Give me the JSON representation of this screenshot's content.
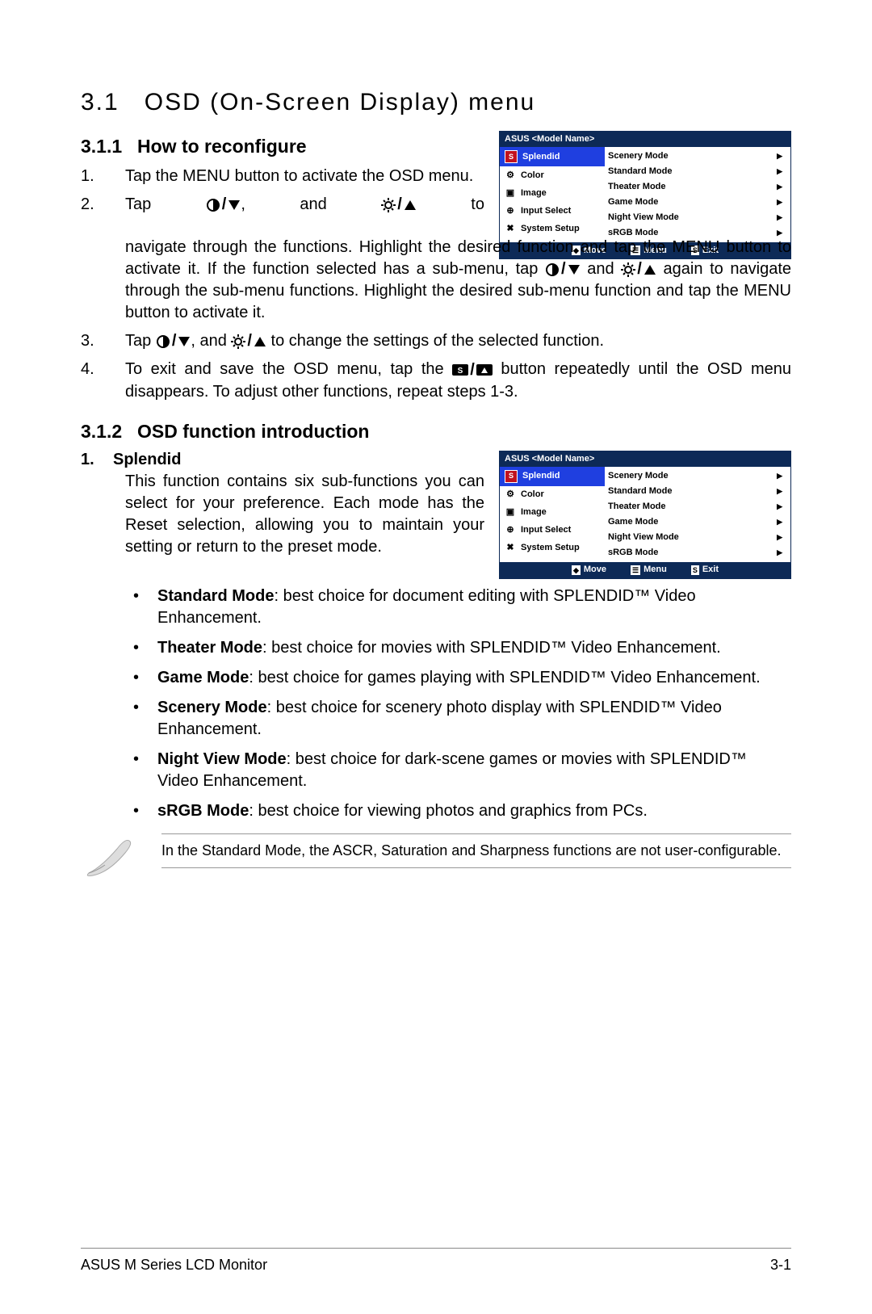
{
  "heading": {
    "num": "3.1",
    "title": "OSD (On-Screen Display) menu"
  },
  "sec311": {
    "num": "3.1.1",
    "title": "How to reconfigure",
    "li1": "Tap the MENU button to activate the OSD menu.",
    "li2a": "Tap ",
    "li2b": ", and ",
    "li2c": " to navigate through the functions. Highlight the desired function and tap the MENU button to activate it. If the function selected has a sub-menu, tap ",
    "li2d": " and ",
    "li2e": " again to navigate through the sub-menu functions. Highlight the desired sub-menu function and tap the MENU button to activate it.",
    "li3a": "Tap ",
    "li3b": ", and ",
    "li3c": " to change the settings of the selected function.",
    "li4a": "To exit and save the OSD menu, tap the ",
    "li4b": " button repeatedly until the OSD menu disappears. To adjust other functions, repeat steps 1-3."
  },
  "sec312": {
    "num": "3.1.2",
    "title": "OSD function introduction",
    "splendid_num": "1.",
    "splendid_title": "Splendid",
    "splendid_body": "This function contains six sub-functions you can select for your preference. Each mode has the Reset selection, allowing you to maintain your setting or return to the preset mode.",
    "bullets": [
      {
        "b": "Standard Mode",
        "t": ": best choice for document editing with SPLENDID™ Video Enhancement."
      },
      {
        "b": "Theater Mode",
        "t": ": best choice for movies with SPLENDID™ Video Enhancement."
      },
      {
        "b": "Game Mode",
        "t": ": best choice for games playing with SPLENDID™ Video Enhancement."
      },
      {
        "b": "Scenery Mode",
        "t": ": best choice for scenery photo display with SPLENDID™ Video Enhancement."
      },
      {
        "b": "Night View Mode",
        "t": ": best choice for dark-scene games or movies with SPLENDID™ Video Enhancement."
      },
      {
        "b": "sRGB Mode",
        "t": ": best choice for viewing photos and graphics from PCs."
      }
    ],
    "note": "In the Standard Mode, the ASCR, Saturation and Sharpness functions are not user-configurable."
  },
  "osd": {
    "title": "ASUS  <Model Name>",
    "left": [
      {
        "icon": "S",
        "label": "Splendid"
      },
      {
        "icon": "⚙",
        "label": "Color"
      },
      {
        "icon": "▣",
        "label": "Image"
      },
      {
        "icon": "⊕",
        "label": "Input Select"
      },
      {
        "icon": "✖",
        "label": "System Setup"
      }
    ],
    "right": [
      "Scenery Mode",
      "Standard Mode",
      "Theater Mode",
      "Game Mode",
      "Night View Mode",
      "sRGB Mode"
    ],
    "footer": {
      "move": "Move",
      "menu": "Menu",
      "exit": "Exit"
    }
  },
  "footer": {
    "left": "ASUS M Series LCD Monitor",
    "right": "3-1"
  }
}
